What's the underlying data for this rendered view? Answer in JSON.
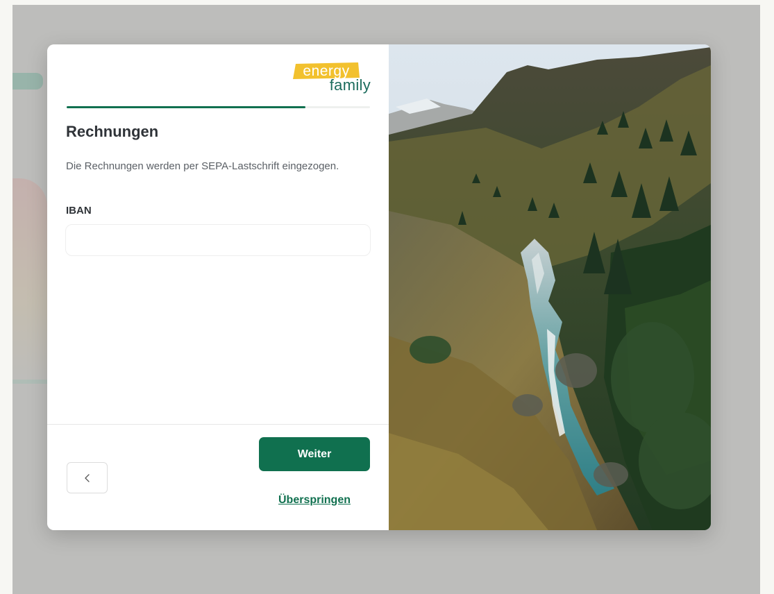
{
  "logo": {
    "line1": "energy",
    "line2": "family"
  },
  "progress": {
    "fraction": 0.787
  },
  "heading": "Rechnungen",
  "description": "Die Rechnungen werden per SEPA-Lastschrift eingezogen.",
  "iban": {
    "label": "IBAN",
    "value": "",
    "placeholder": ""
  },
  "buttons": {
    "next_label": "Weiter",
    "skip_label": "Überspringen"
  },
  "icons": {
    "back": "chevron-left-icon"
  },
  "colors": {
    "accent": "#10704f",
    "logo_highlight": "#f2c12e",
    "logo_text": "#1b6b5c",
    "overlay": "#bdbdbb"
  }
}
